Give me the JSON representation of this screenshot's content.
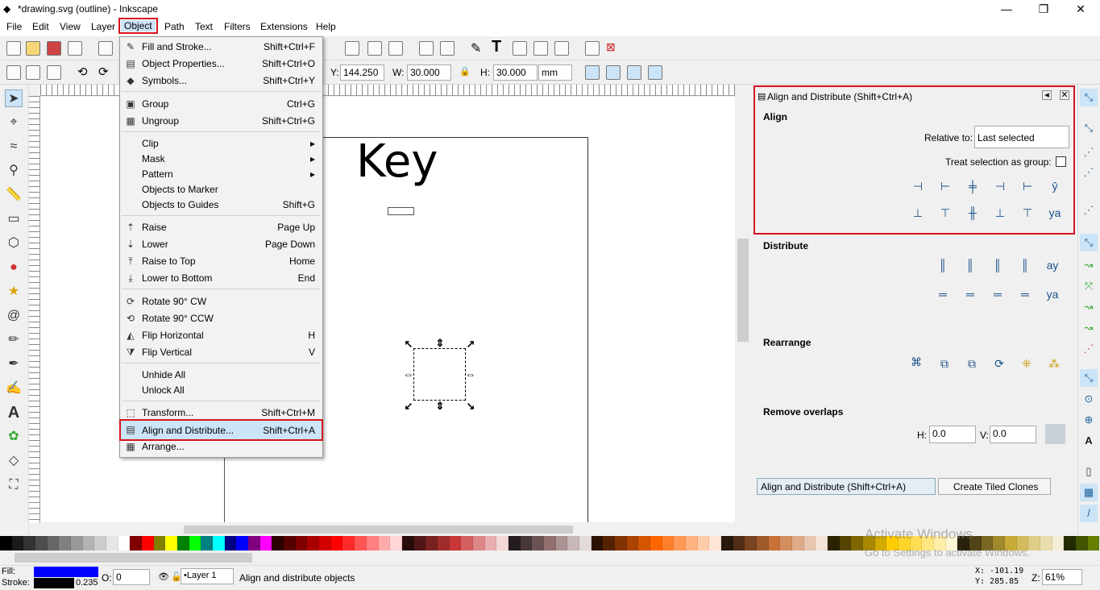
{
  "window": {
    "title": "*drawing.svg (outline) - Inkscape",
    "controls": [
      "—",
      "❐",
      "✕"
    ]
  },
  "menubar": [
    "File",
    "Edit",
    "View",
    "Layer",
    "Object",
    "Path",
    "Text",
    "Filters",
    "Extensions",
    "Help"
  ],
  "toolbar2": {
    "y_label": "Y:",
    "y_value": "144.250",
    "w_label": "W:",
    "w_value": "30.000",
    "h_label": "H:",
    "h_value": "30.000",
    "unit": "mm"
  },
  "canvas": {
    "text": "Key"
  },
  "object_menu": {
    "items": [
      {
        "icon": "fill-stroke-icon",
        "label": "Fill and Stroke...",
        "shortcut": "Shift+Ctrl+F"
      },
      {
        "icon": "object-properties-icon",
        "label": "Object Properties...",
        "shortcut": "Shift+Ctrl+O"
      },
      {
        "icon": "symbols-icon",
        "label": "Symbols...",
        "shortcut": "Shift+Ctrl+Y"
      },
      {
        "icon": "group-icon",
        "label": "Group",
        "shortcut": "Ctrl+G"
      },
      {
        "icon": "ungroup-icon",
        "label": "Ungroup",
        "shortcut": "Shift+Ctrl+G"
      },
      {
        "icon": "",
        "label": "Clip",
        "shortcut": "▸"
      },
      {
        "icon": "",
        "label": "Mask",
        "shortcut": "▸"
      },
      {
        "icon": "",
        "label": "Pattern",
        "shortcut": "▸"
      },
      {
        "icon": "",
        "label": "Objects to Marker",
        "shortcut": ""
      },
      {
        "icon": "",
        "label": "Objects to Guides",
        "shortcut": "Shift+G"
      },
      {
        "icon": "raise-icon",
        "label": "Raise",
        "shortcut": "Page Up"
      },
      {
        "icon": "lower-icon",
        "label": "Lower",
        "shortcut": "Page Down"
      },
      {
        "icon": "raise-to-top-icon",
        "label": "Raise to Top",
        "shortcut": "Home"
      },
      {
        "icon": "lower-to-bottom-icon",
        "label": "Lower to Bottom",
        "shortcut": "End"
      },
      {
        "icon": "rotate-cw-icon",
        "label": "Rotate 90° CW",
        "shortcut": ""
      },
      {
        "icon": "rotate-ccw-icon",
        "label": "Rotate 90° CCW",
        "shortcut": ""
      },
      {
        "icon": "flip-horizontal-icon",
        "label": "Flip Horizontal",
        "shortcut": "H"
      },
      {
        "icon": "flip-vertical-icon",
        "label": "Flip Vertical",
        "shortcut": "V"
      },
      {
        "icon": "",
        "label": "Unhide All",
        "shortcut": ""
      },
      {
        "icon": "",
        "label": "Unlock All",
        "shortcut": ""
      },
      {
        "icon": "transform-icon",
        "label": "Transform...",
        "shortcut": "Shift+Ctrl+M"
      },
      {
        "icon": "align-distribute-icon",
        "label": "Align and Distribute...",
        "shortcut": "Shift+Ctrl+A"
      },
      {
        "icon": "arrange-icon",
        "label": "Arrange...",
        "shortcut": ""
      }
    ]
  },
  "dock": {
    "title": "Align and Distribute (Shift+Ctrl+A)",
    "align_heading": "Align",
    "relative_to_label": "Relative to:",
    "relative_to_value": "Last selected",
    "treat_group_label": "Treat selection as group:",
    "distribute_heading": "Distribute",
    "rearrange_heading": "Rearrange",
    "remove_overlaps_heading": "Remove overlaps",
    "h_label": "H:",
    "h_value": "0.0",
    "v_label": "V:",
    "v_value": "0.0",
    "tab1": "Align and Distribute (Shift+Ctrl+A)",
    "tab2": "Create Tiled Clones"
  },
  "status": {
    "fill_label": "Fill:",
    "stroke_label": "Stroke:",
    "stroke_width": "0.235",
    "opacity_label": "O:",
    "opacity_value": "0",
    "layer": "•Layer 1",
    "message": "Align and distribute objects",
    "x_coord": "X: -101.19",
    "y_coord": "Y:  285.85",
    "zoom_label": "Z:",
    "zoom_value": "61%",
    "fill_color": "#0000ff",
    "stroke_color": "#000000"
  },
  "watermark": {
    "line1": "Activate Windows",
    "line2": "Go to Settings to activate Windows."
  },
  "palette": [
    "#000000",
    "#1a1a1a",
    "#333333",
    "#4d4d4d",
    "#666666",
    "#808080",
    "#999999",
    "#b3b3b3",
    "#cccccc",
    "#e6e6e6",
    "#ffffff",
    "#800000",
    "#ff0000",
    "#808000",
    "#ffff00",
    "#008000",
    "#00ff00",
    "#008080",
    "#00ffff",
    "#000080",
    "#0000ff",
    "#800080",
    "#ff00ff",
    "#2b0000",
    "#550000",
    "#800000",
    "#aa0000",
    "#d40000",
    "#ff0000",
    "#ff2a2a",
    "#ff5555",
    "#ff8080",
    "#ffaaaa",
    "#ffd5d5",
    "#280b0b",
    "#501616",
    "#782121",
    "#a02c2c",
    "#c83737",
    "#d35f5f",
    "#de8787",
    "#e9afaf",
    "#f4d7d7",
    "#241c1c",
    "#483737",
    "#6c5353",
    "#916f6f",
    "#ac9393",
    "#c8b7b7",
    "#e3dbdb",
    "#2b1100",
    "#552200",
    "#803300",
    "#aa4400",
    "#d45500",
    "#ff6600",
    "#ff7f2a",
    "#ff9955",
    "#ffb380",
    "#ffccaa",
    "#ffe6d5",
    "#28170b",
    "#502d16",
    "#784421",
    "#a05a2c",
    "#c87137",
    "#d38d5f",
    "#deaa87",
    "#e9c6af",
    "#f4e3d7",
    "#2b2200",
    "#554400",
    "#806600",
    "#aa8800",
    "#d4aa00",
    "#ffcc00",
    "#ffd42a",
    "#ffdd55",
    "#ffe680",
    "#ffeeaa",
    "#fff6d5",
    "#28220b",
    "#504416",
    "#786721",
    "#a0892c",
    "#c8ab37",
    "#d3bc5f",
    "#decd87",
    "#e9ddaf",
    "#f4eed7",
    "#222b00",
    "#445500",
    "#668000"
  ]
}
